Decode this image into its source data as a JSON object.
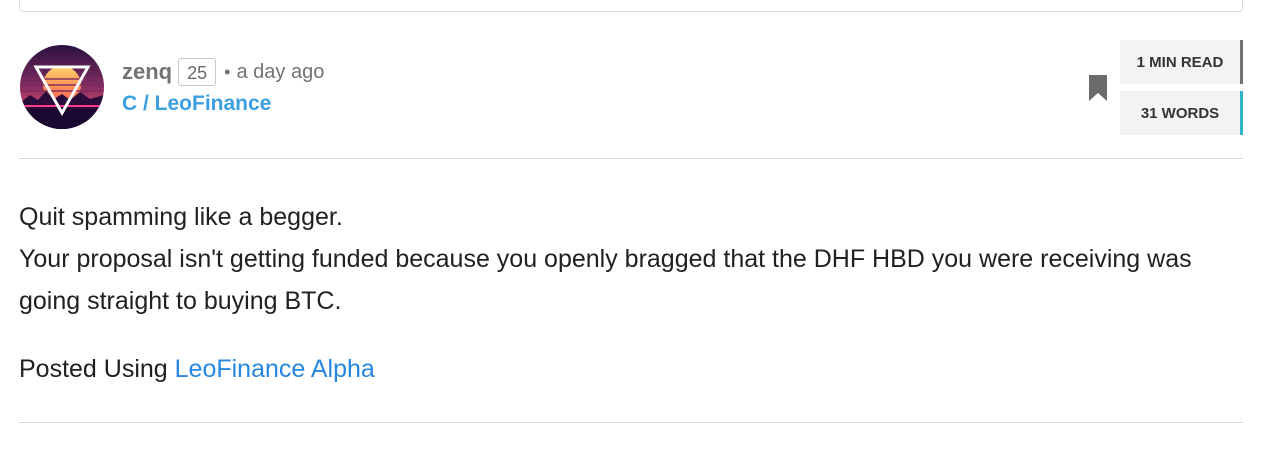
{
  "post": {
    "author": "zenq",
    "reputation": "25",
    "separator": "•",
    "time": "a day ago",
    "community": "C / LeoFinance",
    "avatar_icon": "synthwave-triangle-avatar",
    "bookmark_icon": "bookmark-icon"
  },
  "stats": {
    "read_time": "1 MIN READ",
    "word_count": "31 WORDS"
  },
  "content": {
    "line1": "Quit spamming like a begger.",
    "line2": "Your proposal isn't getting funded because you openly bragged that the DHF HBD you were receiving was going straight to buying BTC.",
    "posted_prefix": "Posted Using ",
    "posted_link": "LeoFinance Alpha"
  },
  "colors": {
    "link": "#2787e0",
    "community": "#3c9fe0",
    "meta": "#737373",
    "read_accent": "#6e7377",
    "words_accent": "#2fb3c6"
  }
}
